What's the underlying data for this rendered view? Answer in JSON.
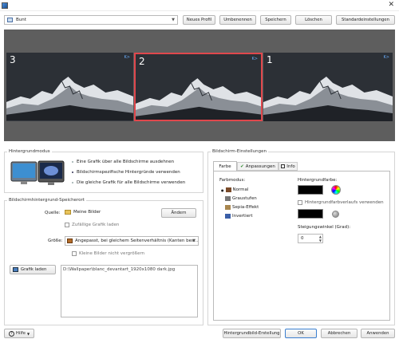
{
  "profile": {
    "selected": "Bunt"
  },
  "toolbar": {
    "new_profile": "Neues Profil",
    "rename": "Umbenennen",
    "save": "Speichern",
    "delete": "Löschen",
    "defaults": "Standardeinstellungen"
  },
  "monitors": [
    {
      "number": "3",
      "indicator": "K>"
    },
    {
      "number": "2",
      "indicator": "K>"
    },
    {
      "number": "1",
      "indicator": "K>"
    }
  ],
  "background_mode": {
    "legend": "Hintergrundmodus",
    "options": [
      "Eine Grafik über alle Bildschirme ausdehnen",
      "Bildschirmspezifische Hintergründe verwenden",
      "Die gleiche Grafik für alle Bildschirme verwenden"
    ]
  },
  "storage": {
    "legend": "Bildschirmhintergrund-Speicherort",
    "source_label": "Quelle:",
    "source_value": "Meine Bilder",
    "change_button": "Ändern",
    "random_label": "Zufällige Grafik laden",
    "size_label": "Größe:",
    "size_value": "Angepasst, bei gleichem Seitenverhältnis (Kanten bes...",
    "no_enlarge_label": "Kleine Bilder nicht vergrößern",
    "load_button": "Grafik laden",
    "path": "D:\\Wallpaper\\blanc_devantart_1920x1080 dark.jpg"
  },
  "screen_settings": {
    "legend": "Bildschirm-Einstellungen",
    "tabs": [
      "Farbe",
      "Anpassungen",
      "Info"
    ],
    "color_mode_label": "Farbmodus:",
    "color_modes": [
      "Normal",
      "Graustufen",
      "Sepia-Effekt",
      "Invertiert"
    ],
    "bg_color_label": "Hintergrundfarbe:",
    "gradient_label": "Hintergrundfarbverlaufs verwenden",
    "gradient_angle_label": "Steigungswinkel (Grad):",
    "gradient_angle_value": "0"
  },
  "bottom": {
    "help": "Hilfe",
    "create_bg": "Hintergrundbild-Erstellung",
    "ok": "OK",
    "cancel": "Abbrechen",
    "apply": "Anwenden"
  },
  "colors": {
    "selected_monitor_border": "#e0474c",
    "monitor_area_bg": "#5e5e5e",
    "swatch": "#000000"
  }
}
